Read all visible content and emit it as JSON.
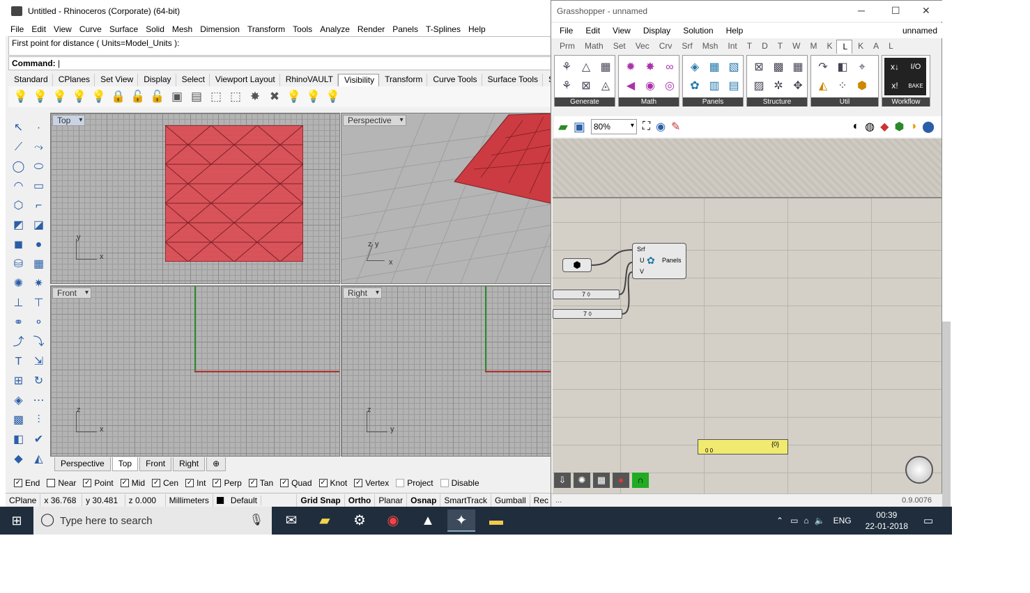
{
  "rhino": {
    "title": "Untitled - Rhinoceros (Corporate) (64-bit)",
    "menu": [
      "File",
      "Edit",
      "View",
      "Curve",
      "Surface",
      "Solid",
      "Mesh",
      "Dimension",
      "Transform",
      "Tools",
      "Analyze",
      "Render",
      "Panels",
      "T-Splines",
      "Help"
    ],
    "command_history": "First point for distance ( Units=Model_Units ):",
    "command_label": "Command:",
    "toolbar_tabs": [
      "Standard",
      "CPlanes",
      "Set View",
      "Display",
      "Select",
      "Viewport Layout",
      "RhinoVAULT",
      "Visibility",
      "Transform",
      "Curve Tools",
      "Surface Tools",
      "Solid"
    ],
    "active_toolbar_tab": "Visibility",
    "viewports": {
      "top": "Top",
      "perspective": "Perspective",
      "front": "Front",
      "right": "Right"
    },
    "axes": {
      "x": "x",
      "y": "y",
      "z": "z"
    },
    "viewport_tabs": [
      "Perspective",
      "Top",
      "Front",
      "Right",
      "⊕"
    ],
    "active_viewport_tab": "Top",
    "osnaps": [
      {
        "label": "End",
        "checked": true
      },
      {
        "label": "Near",
        "checked": false
      },
      {
        "label": "Point",
        "checked": true
      },
      {
        "label": "Mid",
        "checked": true
      },
      {
        "label": "Cen",
        "checked": true
      },
      {
        "label": "Int",
        "checked": true
      },
      {
        "label": "Perp",
        "checked": true
      },
      {
        "label": "Tan",
        "checked": true
      },
      {
        "label": "Quad",
        "checked": true
      },
      {
        "label": "Knot",
        "checked": true
      },
      {
        "label": "Vertex",
        "checked": true
      },
      {
        "label": "Project",
        "checked": false
      },
      {
        "label": "Disable",
        "checked": false
      }
    ],
    "status": {
      "cplane": "CPlane",
      "x": "x 36.768",
      "y": "y 30.481",
      "z": "z 0.000",
      "units": "Millimeters",
      "layer": "Default",
      "grid_snap": "Grid Snap",
      "ortho": "Ortho",
      "planar": "Planar",
      "osnap": "Osnap",
      "smarttrack": "SmartTrack",
      "gumball": "Gumball",
      "rec": "Rec"
    },
    "surface_color": "#d9535a"
  },
  "grasshopper": {
    "title": "Grasshopper - unnamed",
    "menu": [
      "File",
      "Edit",
      "View",
      "Display",
      "Solution",
      "Help"
    ],
    "doc_name": "unnamed",
    "tabs": [
      "Prm",
      "Math",
      "Set",
      "Vec",
      "Crv",
      "Srf",
      "Msh",
      "Int",
      "T",
      "D",
      "T",
      "W",
      "M",
      "K",
      "L",
      "K",
      "A",
      "L"
    ],
    "active_tab_index": 14,
    "groups": [
      "Generate",
      "Math",
      "Panels",
      "Structure",
      "Util",
      "Workflow"
    ],
    "zoom": "80%",
    "component": {
      "inputs": [
        "Srf",
        "U",
        "V"
      ],
      "name": "Panels"
    },
    "sliders": [
      {
        "value": "7 ◊"
      },
      {
        "value": "7 ◊"
      }
    ],
    "panel": {
      "path": "{0}",
      "content": "0 0"
    },
    "version": "0.9.0076",
    "status_left": "..."
  },
  "taskbar": {
    "search_placeholder": "Type here to search",
    "lang": "ENG",
    "time": "00:39",
    "date": "22-01-2018"
  }
}
